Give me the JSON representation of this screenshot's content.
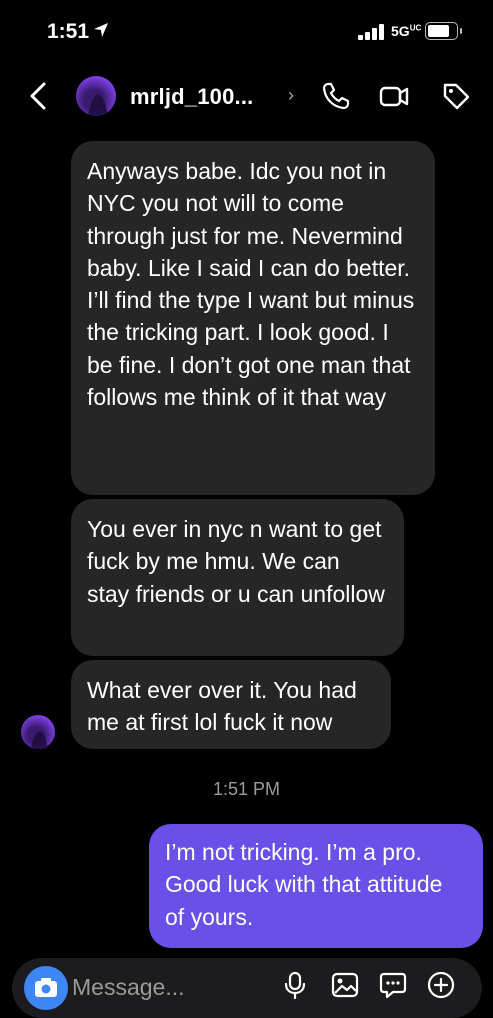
{
  "status_bar": {
    "time": "1:51",
    "network": "5G",
    "network_suffix": "UC"
  },
  "header": {
    "username": "mrljd_100..."
  },
  "messages": [
    {
      "from": "them",
      "text": "Anyways babe. Idc you not in NYC you not will to come through just for me. Nevermind baby. Like I said I can do better. I’ll find the type I want but minus the tricking part. I look good. I be fine. I don’t got one man that follows me think of it that way"
    },
    {
      "from": "them",
      "text": "You ever in nyc n want to get fuck by me hmu. We can stay friends or u can unfollow"
    },
    {
      "from": "them",
      "text": "What ever over it. You had me at first lol fuck it now"
    },
    {
      "from": "me",
      "text": "I’m not tricking. I’m a pro. Good luck with that attitude of yours."
    }
  ],
  "timestamp": "1:51 PM",
  "composer": {
    "placeholder": "Message..."
  },
  "colors": {
    "outgoing_bubble": "#6a4fe8",
    "incoming_bubble": "#262626",
    "camera_button": "#3f86f5"
  }
}
